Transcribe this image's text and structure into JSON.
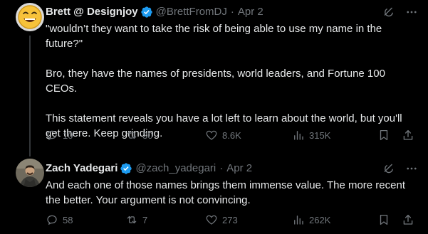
{
  "tweets": [
    {
      "author": {
        "name": "Brett @ Designjoy",
        "handle": "@BrettFromDJ",
        "verified": true,
        "avatar_icon": "smiley-face-avatar"
      },
      "separator": "·",
      "date": "Apr 2",
      "header_icons": [
        "grok-icon",
        "more-icon"
      ],
      "paragraphs": [
        "\"wouldn’t they want to take the risk of being able to use my name in the future?\"",
        "Bro, they have the names of presidents, world leaders, and Fortune 100 CEOs.",
        "This statement reveals you have a lot left to learn about the world, but you'll get there. Keep grinding."
      ],
      "stats": {
        "replies": "10",
        "reposts": "30",
        "likes": "8.6K",
        "views": "315K"
      }
    },
    {
      "author": {
        "name": "Zach Yadegari",
        "handle": "@zach_yadegari",
        "verified": true,
        "avatar_icon": "person-photo-avatar"
      },
      "separator": "·",
      "date": "Apr 2",
      "header_icons": [
        "grok-icon",
        "more-icon"
      ],
      "paragraphs": [
        "And each one of those names brings them immense value. The more recent the better. Your argument is not convincing."
      ],
      "stats": {
        "replies": "58",
        "reposts": "7",
        "likes": "273",
        "views": "262K"
      }
    }
  ],
  "colors": {
    "background": "#000000",
    "text": "#e7e9ea",
    "muted": "#71767b",
    "verified": "#1d9bf0",
    "divider": "#2f3336"
  }
}
